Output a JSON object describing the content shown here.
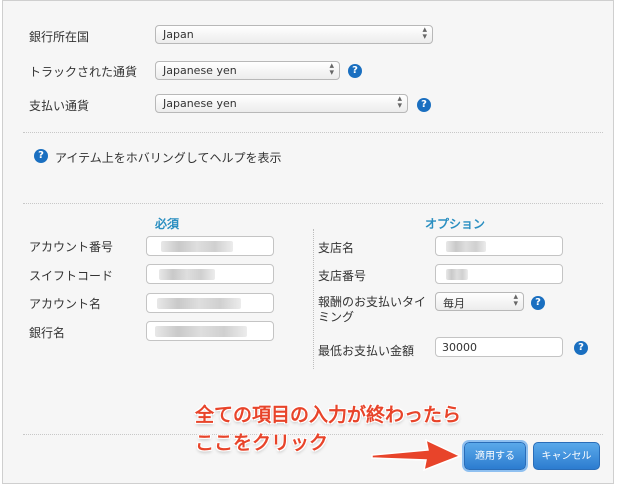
{
  "bank_info": {
    "country_label": "銀行所在国",
    "country_value": "Japan",
    "tracked_currency_label": "トラックされた通貨",
    "tracked_currency_value": "Japanese yen",
    "payment_currency_label": "支払い通貨",
    "payment_currency_value": "Japanese yen"
  },
  "help": {
    "hover_text": "アイテム上をホバリングしてヘルプを表示",
    "icon_glyph": "?"
  },
  "required": {
    "title": "必須",
    "fields": [
      {
        "label": "アカウント番号"
      },
      {
        "label": "スイフトコード"
      },
      {
        "label": "アカウント名"
      },
      {
        "label": "銀行名"
      }
    ]
  },
  "optional": {
    "title": "オプション",
    "branch_name_label": "支店名",
    "branch_number_label": "支店番号",
    "payment_timing_label": "報酬のお支払いタイミング",
    "payment_timing_value": "毎月",
    "min_amount_label": "最低お支払い金額",
    "min_amount_value": "30000"
  },
  "buttons": {
    "apply": "適用する",
    "cancel": "キャンセル"
  },
  "annotation": {
    "line1": "全ての項目の入力が終わったら",
    "line2": "ここをクリック"
  },
  "colors": {
    "accent": "#2b8fc1",
    "button": "#3584d6",
    "annotation": "#e8442a",
    "help_icon": "#1a6fc0"
  }
}
